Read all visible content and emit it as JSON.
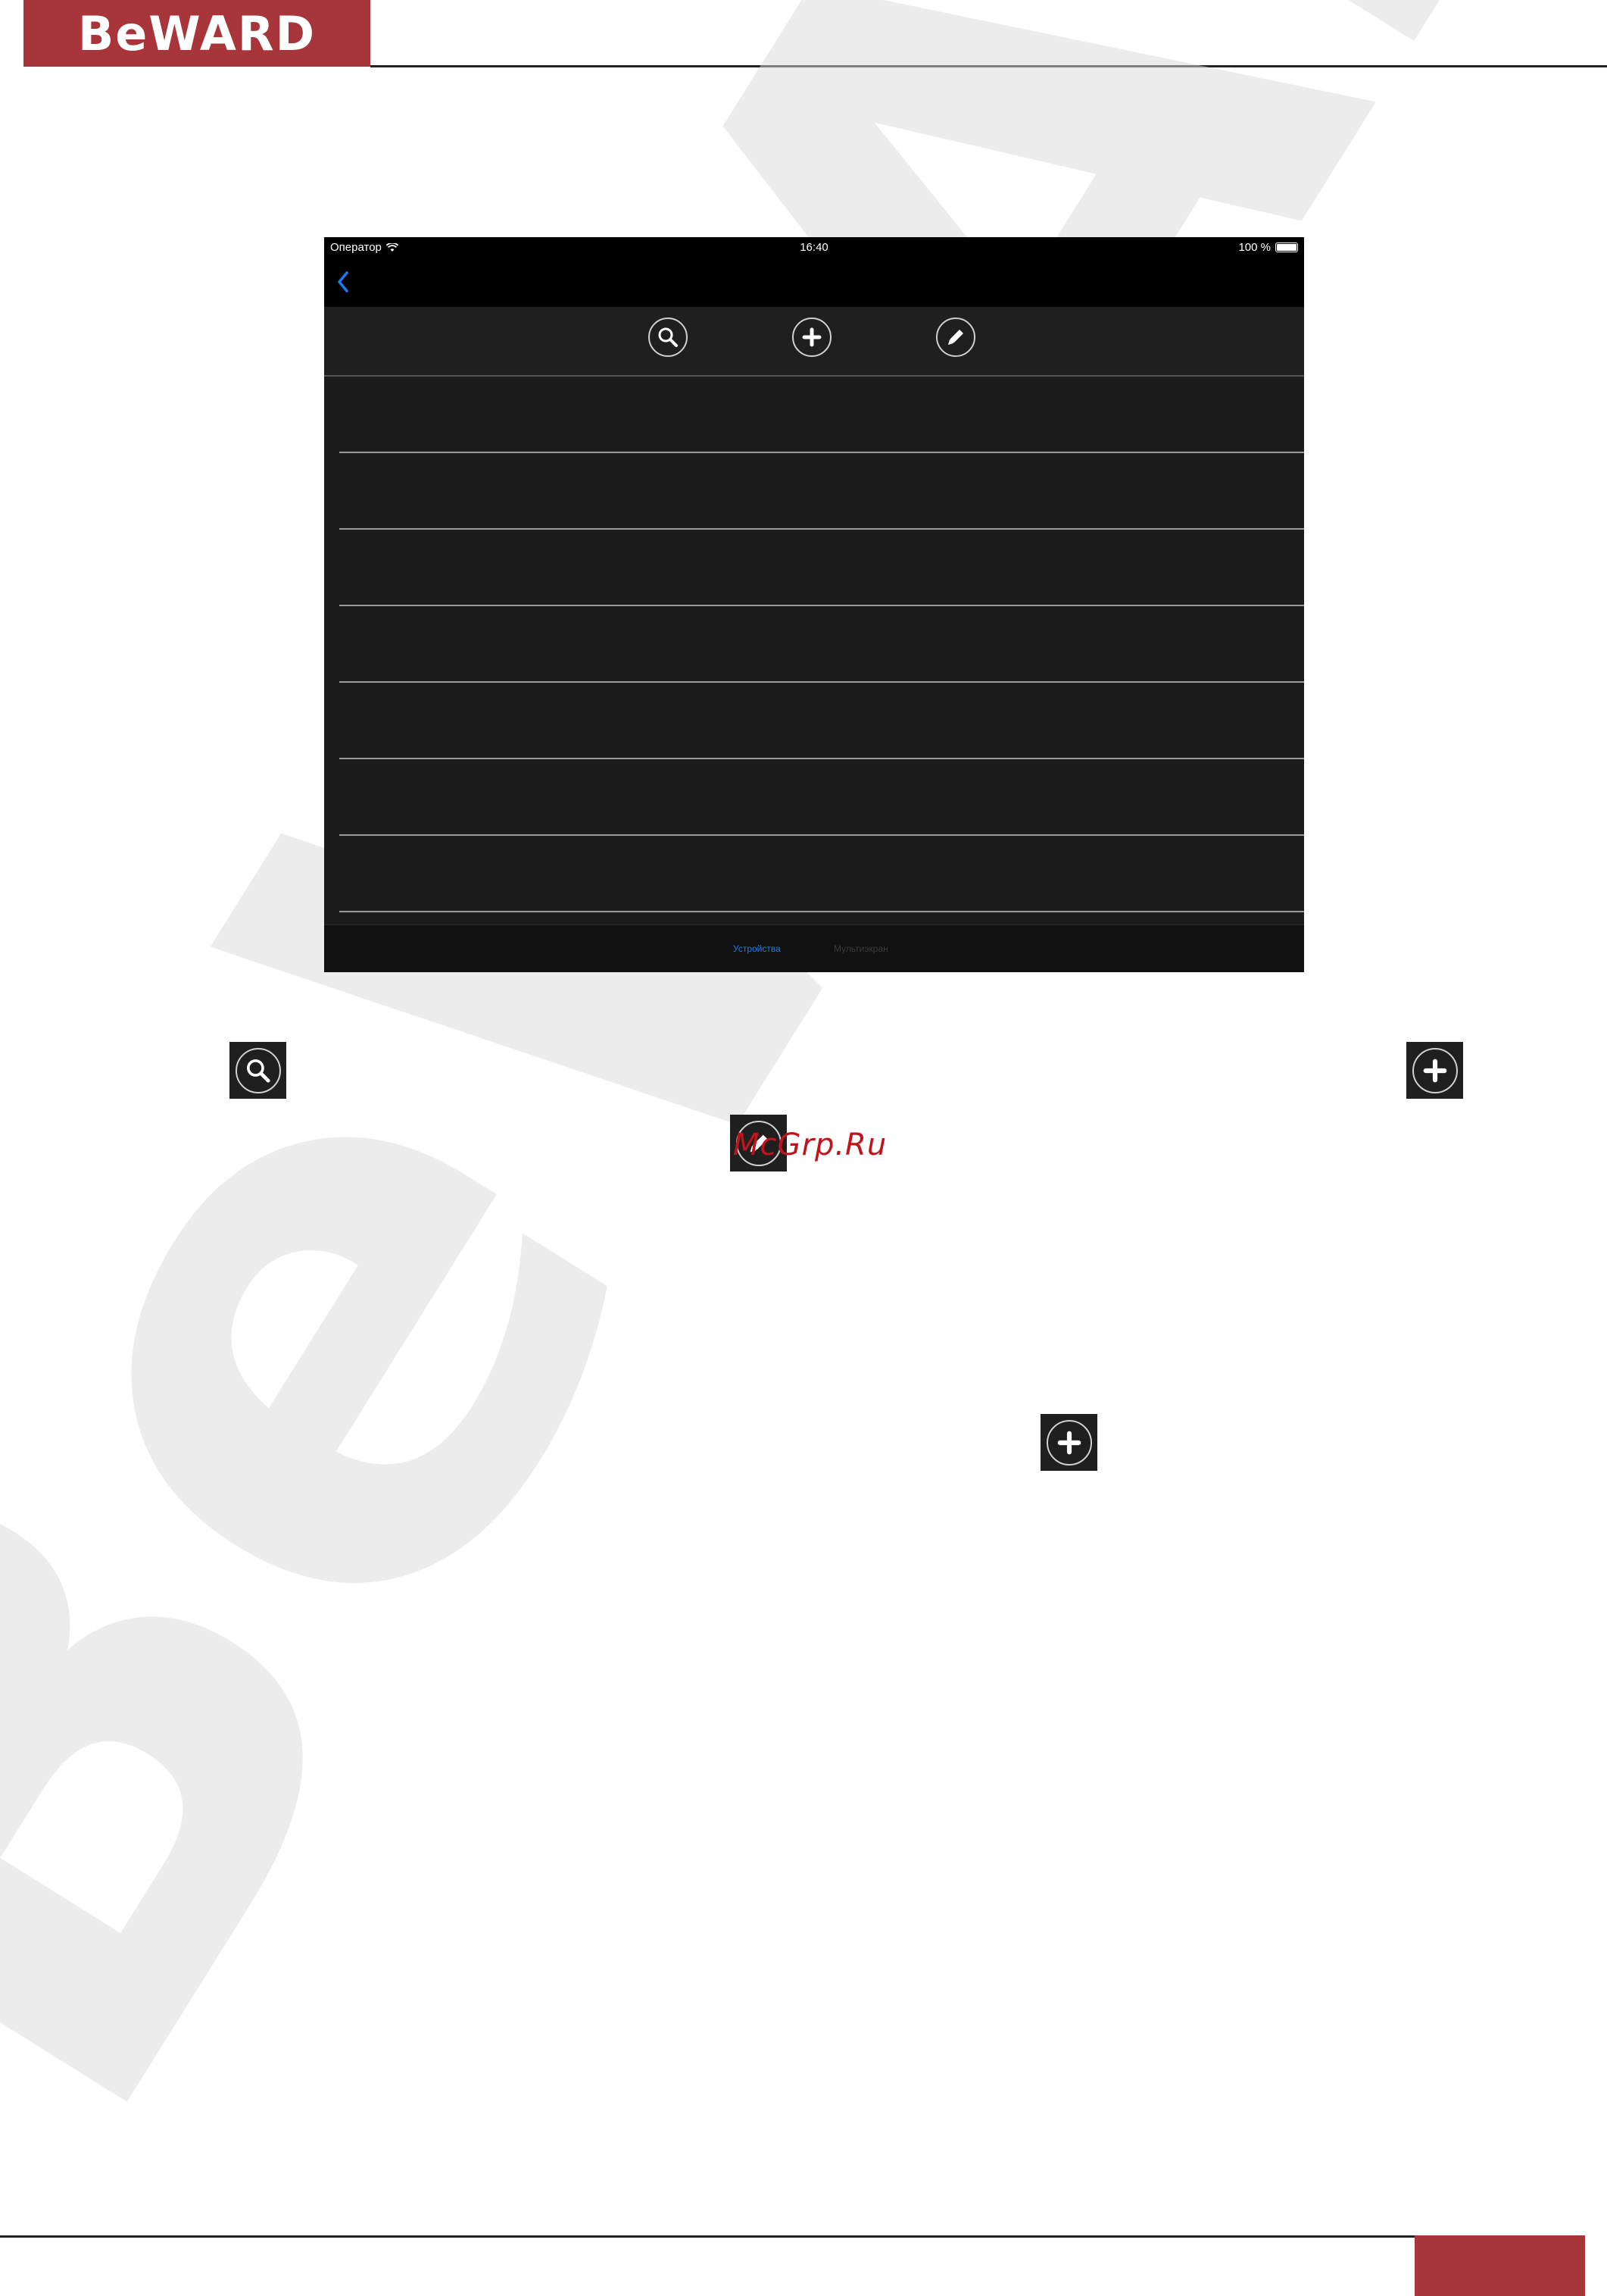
{
  "header": {
    "logo_text": "BeWARD"
  },
  "watermark": {
    "text": "BeWARD"
  },
  "screenshot": {
    "status_bar": {
      "carrier": "Оператор",
      "time": "16:40",
      "battery": "100 %"
    },
    "nav_bar": {
      "back_icon": "chevron-left-icon"
    },
    "toolbar": {
      "icons": [
        "search-icon",
        "plus-icon",
        "pencil-icon"
      ]
    },
    "list_rows": 7,
    "tab_bar": {
      "tabs": [
        "Устройства",
        "Мультиэкран"
      ],
      "active_index": 0
    }
  },
  "inline_icons": {
    "search": "search-icon",
    "add_right": "plus-icon",
    "edit": "pencil-icon",
    "add_lower": "plus-icon"
  },
  "overlay_text": "McGrp.Ru",
  "colors": {
    "brand": "#a8353a",
    "accent": "#1a7cf5",
    "panel": "#1c1c1c"
  }
}
